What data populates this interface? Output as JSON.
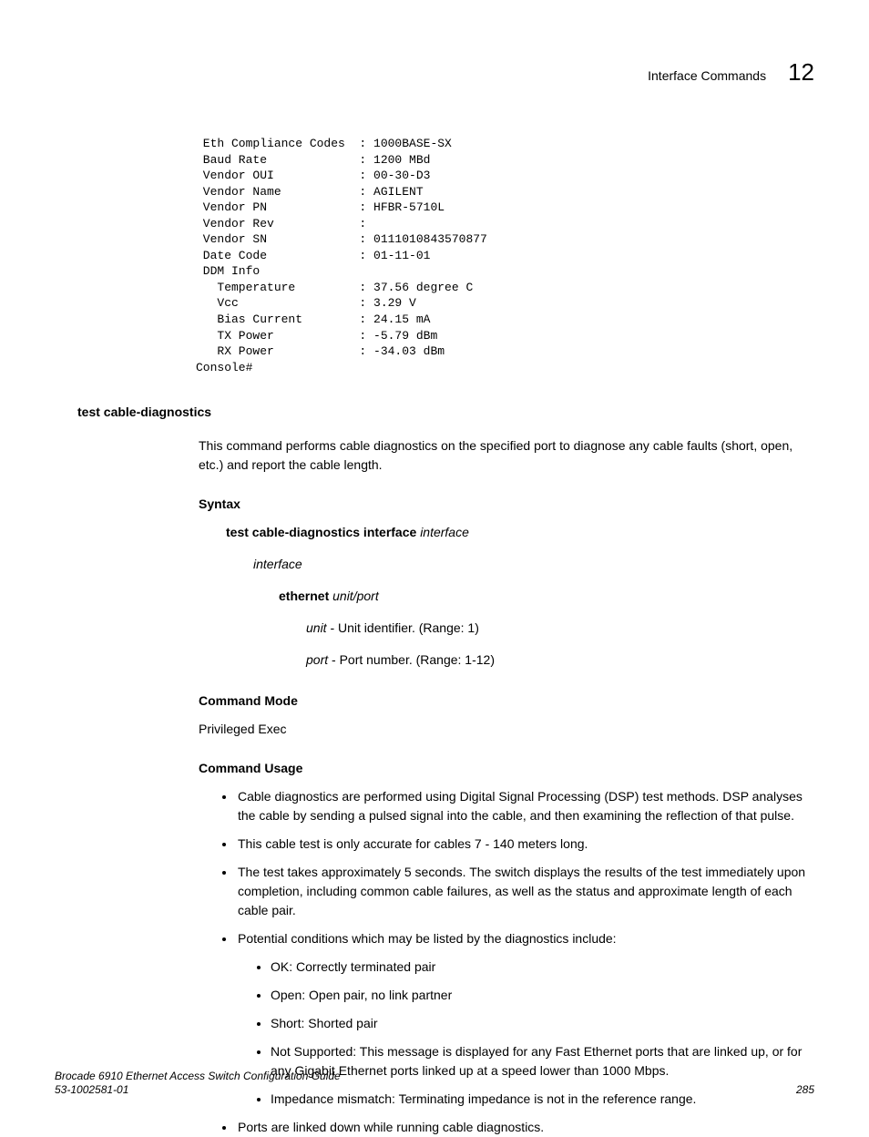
{
  "header": {
    "title": "Interface Commands",
    "chapter": "12"
  },
  "code": " Eth Compliance Codes  : 1000BASE-SX\n Baud Rate             : 1200 MBd\n Vendor OUI            : 00-30-D3\n Vendor Name           : AGILENT\n Vendor PN             : HFBR-5710L\n Vendor Rev            :\n Vendor SN             : 0111010843570877\n Date Code             : 01-11-01\n DDM Info\n   Temperature         : 37.56 degree C\n   Vcc                 : 3.29 V\n   Bias Current        : 24.15 mA\n   TX Power            : -5.79 dBm\n   RX Power            : -34.03 dBm\nConsole#",
  "command_name": "test cable-diagnostics",
  "description": "This command performs cable diagnostics on the specified port to diagnose any cable faults (short, open, etc.) and report the cable length.",
  "syntax": {
    "heading": "Syntax",
    "line_bold": "test cable-diagnostics interface",
    "line_italic": "interface",
    "interface_label": "interface",
    "ethernet_bold": "ethernet",
    "ethernet_italic": "unit/port",
    "unit_italic": "unit",
    "unit_desc": " - Unit identifier. (Range: 1)",
    "port_italic": "port",
    "port_desc": " - Port number. (Range: 1-12)"
  },
  "command_mode": {
    "heading": "Command Mode",
    "value": "Privileged Exec"
  },
  "command_usage": {
    "heading": "Command Usage",
    "items": [
      "Cable diagnostics are performed using Digital Signal Processing (DSP) test methods. DSP analyses the cable by sending a pulsed signal into the cable, and then examining the reflection of that pulse.",
      "This cable test is only accurate for cables 7 - 140 meters long.",
      "The test takes approximately 5 seconds. The switch displays the results of the test immediately upon completion, including common cable failures, as well as the status and approximate length of each cable pair.",
      "Potential conditions which may be listed by the diagnostics include:",
      "Ports are linked down while running cable diagnostics."
    ],
    "sub_items": [
      "OK: Correctly terminated pair",
      "Open: Open pair, no link partner",
      "Short: Shorted pair",
      "Not Supported: This message is displayed for any Fast Ethernet ports that are linked up, or for any Gigabit Ethernet ports linked up at a speed lower than 1000 Mbps.",
      "Impedance mismatch: Terminating impedance is not in the reference range."
    ]
  },
  "footer": {
    "title": "Brocade 6910 Ethernet Access Switch Configuration Guide",
    "docnum": "53-1002581-01",
    "page": "285"
  }
}
